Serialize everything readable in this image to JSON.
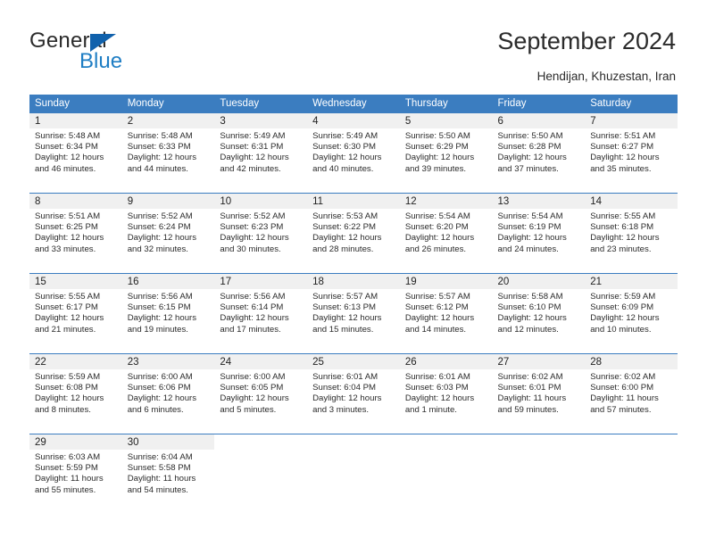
{
  "brand": {
    "name_top": "General",
    "name_bottom": "Blue",
    "accent_color": "#1f7ec4",
    "triangle_color": "#1061ac"
  },
  "header": {
    "title": "September 2024",
    "subtitle": "Hendijan, Khuzestan, Iran"
  },
  "colors": {
    "header_row_bg": "#3b7dc0",
    "header_row_text": "#ffffff",
    "day_number_band_bg": "#f0f0f0",
    "text": "#2b2b2b",
    "page_bg": "#ffffff"
  },
  "weekdays": [
    "Sunday",
    "Monday",
    "Tuesday",
    "Wednesday",
    "Thursday",
    "Friday",
    "Saturday"
  ],
  "labels": {
    "sunrise_prefix": "Sunrise:",
    "sunset_prefix": "Sunset:",
    "daylight_prefix": "Daylight:"
  },
  "weeks": [
    [
      {
        "day": "1",
        "sunrise": "Sunrise: 5:48 AM",
        "sunset": "Sunset: 6:34 PM",
        "daylight_line1": "Daylight: 12 hours",
        "daylight_line2": "and 46 minutes."
      },
      {
        "day": "2",
        "sunrise": "Sunrise: 5:48 AM",
        "sunset": "Sunset: 6:33 PM",
        "daylight_line1": "Daylight: 12 hours",
        "daylight_line2": "and 44 minutes."
      },
      {
        "day": "3",
        "sunrise": "Sunrise: 5:49 AM",
        "sunset": "Sunset: 6:31 PM",
        "daylight_line1": "Daylight: 12 hours",
        "daylight_line2": "and 42 minutes."
      },
      {
        "day": "4",
        "sunrise": "Sunrise: 5:49 AM",
        "sunset": "Sunset: 6:30 PM",
        "daylight_line1": "Daylight: 12 hours",
        "daylight_line2": "and 40 minutes."
      },
      {
        "day": "5",
        "sunrise": "Sunrise: 5:50 AM",
        "sunset": "Sunset: 6:29 PM",
        "daylight_line1": "Daylight: 12 hours",
        "daylight_line2": "and 39 minutes."
      },
      {
        "day": "6",
        "sunrise": "Sunrise: 5:50 AM",
        "sunset": "Sunset: 6:28 PM",
        "daylight_line1": "Daylight: 12 hours",
        "daylight_line2": "and 37 minutes."
      },
      {
        "day": "7",
        "sunrise": "Sunrise: 5:51 AM",
        "sunset": "Sunset: 6:27 PM",
        "daylight_line1": "Daylight: 12 hours",
        "daylight_line2": "and 35 minutes."
      }
    ],
    [
      {
        "day": "8",
        "sunrise": "Sunrise: 5:51 AM",
        "sunset": "Sunset: 6:25 PM",
        "daylight_line1": "Daylight: 12 hours",
        "daylight_line2": "and 33 minutes."
      },
      {
        "day": "9",
        "sunrise": "Sunrise: 5:52 AM",
        "sunset": "Sunset: 6:24 PM",
        "daylight_line1": "Daylight: 12 hours",
        "daylight_line2": "and 32 minutes."
      },
      {
        "day": "10",
        "sunrise": "Sunrise: 5:52 AM",
        "sunset": "Sunset: 6:23 PM",
        "daylight_line1": "Daylight: 12 hours",
        "daylight_line2": "and 30 minutes."
      },
      {
        "day": "11",
        "sunrise": "Sunrise: 5:53 AM",
        "sunset": "Sunset: 6:22 PM",
        "daylight_line1": "Daylight: 12 hours",
        "daylight_line2": "and 28 minutes."
      },
      {
        "day": "12",
        "sunrise": "Sunrise: 5:54 AM",
        "sunset": "Sunset: 6:20 PM",
        "daylight_line1": "Daylight: 12 hours",
        "daylight_line2": "and 26 minutes."
      },
      {
        "day": "13",
        "sunrise": "Sunrise: 5:54 AM",
        "sunset": "Sunset: 6:19 PM",
        "daylight_line1": "Daylight: 12 hours",
        "daylight_line2": "and 24 minutes."
      },
      {
        "day": "14",
        "sunrise": "Sunrise: 5:55 AM",
        "sunset": "Sunset: 6:18 PM",
        "daylight_line1": "Daylight: 12 hours",
        "daylight_line2": "and 23 minutes."
      }
    ],
    [
      {
        "day": "15",
        "sunrise": "Sunrise: 5:55 AM",
        "sunset": "Sunset: 6:17 PM",
        "daylight_line1": "Daylight: 12 hours",
        "daylight_line2": "and 21 minutes."
      },
      {
        "day": "16",
        "sunrise": "Sunrise: 5:56 AM",
        "sunset": "Sunset: 6:15 PM",
        "daylight_line1": "Daylight: 12 hours",
        "daylight_line2": "and 19 minutes."
      },
      {
        "day": "17",
        "sunrise": "Sunrise: 5:56 AM",
        "sunset": "Sunset: 6:14 PM",
        "daylight_line1": "Daylight: 12 hours",
        "daylight_line2": "and 17 minutes."
      },
      {
        "day": "18",
        "sunrise": "Sunrise: 5:57 AM",
        "sunset": "Sunset: 6:13 PM",
        "daylight_line1": "Daylight: 12 hours",
        "daylight_line2": "and 15 minutes."
      },
      {
        "day": "19",
        "sunrise": "Sunrise: 5:57 AM",
        "sunset": "Sunset: 6:12 PM",
        "daylight_line1": "Daylight: 12 hours",
        "daylight_line2": "and 14 minutes."
      },
      {
        "day": "20",
        "sunrise": "Sunrise: 5:58 AM",
        "sunset": "Sunset: 6:10 PM",
        "daylight_line1": "Daylight: 12 hours",
        "daylight_line2": "and 12 minutes."
      },
      {
        "day": "21",
        "sunrise": "Sunrise: 5:59 AM",
        "sunset": "Sunset: 6:09 PM",
        "daylight_line1": "Daylight: 12 hours",
        "daylight_line2": "and 10 minutes."
      }
    ],
    [
      {
        "day": "22",
        "sunrise": "Sunrise: 5:59 AM",
        "sunset": "Sunset: 6:08 PM",
        "daylight_line1": "Daylight: 12 hours",
        "daylight_line2": "and 8 minutes."
      },
      {
        "day": "23",
        "sunrise": "Sunrise: 6:00 AM",
        "sunset": "Sunset: 6:06 PM",
        "daylight_line1": "Daylight: 12 hours",
        "daylight_line2": "and 6 minutes."
      },
      {
        "day": "24",
        "sunrise": "Sunrise: 6:00 AM",
        "sunset": "Sunset: 6:05 PM",
        "daylight_line1": "Daylight: 12 hours",
        "daylight_line2": "and 5 minutes."
      },
      {
        "day": "25",
        "sunrise": "Sunrise: 6:01 AM",
        "sunset": "Sunset: 6:04 PM",
        "daylight_line1": "Daylight: 12 hours",
        "daylight_line2": "and 3 minutes."
      },
      {
        "day": "26",
        "sunrise": "Sunrise: 6:01 AM",
        "sunset": "Sunset: 6:03 PM",
        "daylight_line1": "Daylight: 12 hours",
        "daylight_line2": "and 1 minute."
      },
      {
        "day": "27",
        "sunrise": "Sunrise: 6:02 AM",
        "sunset": "Sunset: 6:01 PM",
        "daylight_line1": "Daylight: 11 hours",
        "daylight_line2": "and 59 minutes."
      },
      {
        "day": "28",
        "sunrise": "Sunrise: 6:02 AM",
        "sunset": "Sunset: 6:00 PM",
        "daylight_line1": "Daylight: 11 hours",
        "daylight_line2": "and 57 minutes."
      }
    ],
    [
      {
        "day": "29",
        "sunrise": "Sunrise: 6:03 AM",
        "sunset": "Sunset: 5:59 PM",
        "daylight_line1": "Daylight: 11 hours",
        "daylight_line2": "and 55 minutes."
      },
      {
        "day": "30",
        "sunrise": "Sunrise: 6:04 AM",
        "sunset": "Sunset: 5:58 PM",
        "daylight_line1": "Daylight: 11 hours",
        "daylight_line2": "and 54 minutes."
      },
      {
        "day": "",
        "sunrise": "",
        "sunset": "",
        "daylight_line1": "",
        "daylight_line2": ""
      },
      {
        "day": "",
        "sunrise": "",
        "sunset": "",
        "daylight_line1": "",
        "daylight_line2": ""
      },
      {
        "day": "",
        "sunrise": "",
        "sunset": "",
        "daylight_line1": "",
        "daylight_line2": ""
      },
      {
        "day": "",
        "sunrise": "",
        "sunset": "",
        "daylight_line1": "",
        "daylight_line2": ""
      },
      {
        "day": "",
        "sunrise": "",
        "sunset": "",
        "daylight_line1": "",
        "daylight_line2": ""
      }
    ]
  ]
}
